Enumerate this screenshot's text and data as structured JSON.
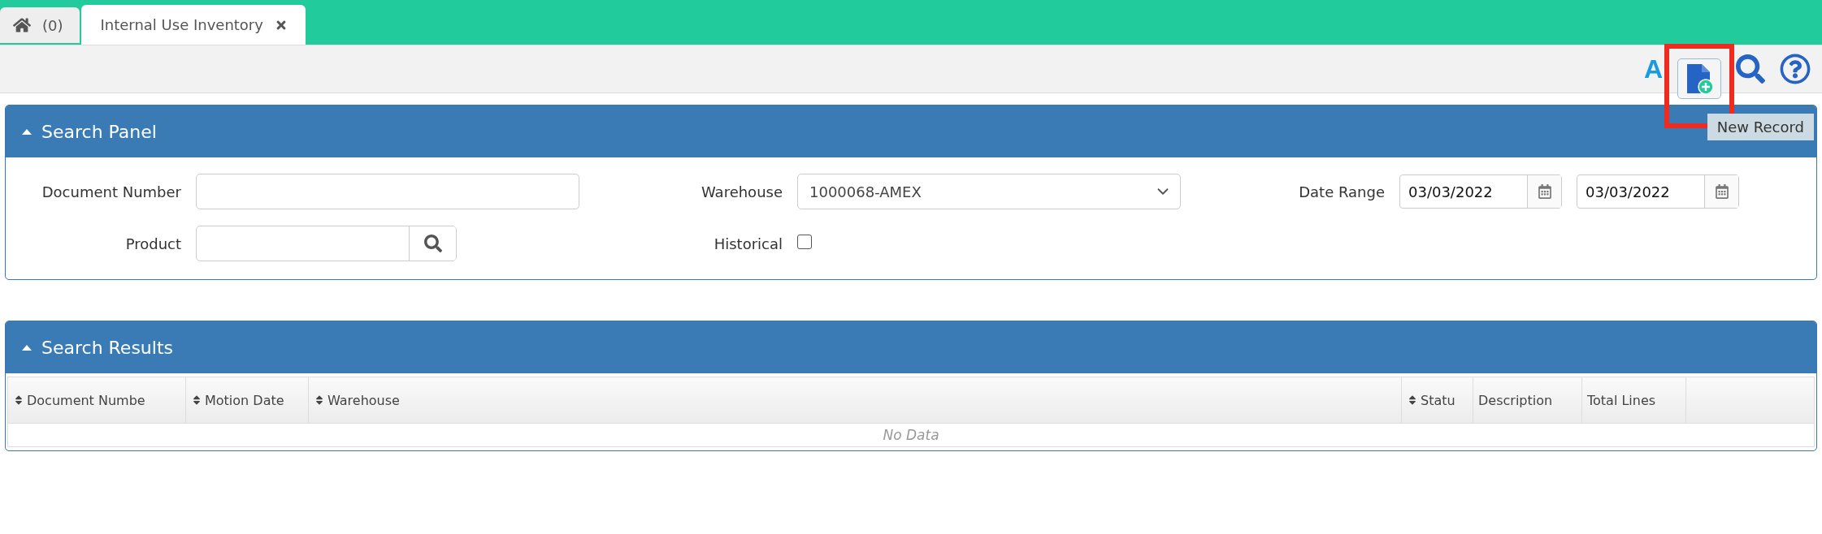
{
  "tabs": [
    {
      "kind": "home",
      "label": "(0)",
      "selected": false
    },
    {
      "kind": "page",
      "label": "Internal Use Inventory",
      "selected": true,
      "closable": true
    }
  ],
  "toolbar": {
    "font_button": "A",
    "new_record": {
      "highlighted": true,
      "tooltip": "New Record"
    }
  },
  "search_panel": {
    "title": "Search Panel",
    "expanded": true,
    "rows": [
      [
        {
          "kind": "text",
          "label": "Document Number"
        },
        {
          "kind": "select",
          "label": "Warehouse",
          "value": "1000068-AMEX"
        },
        {
          "kind": "daterange",
          "label": "Date Range",
          "values": [
            "03/03/2022",
            "03/03/2022"
          ]
        }
      ],
      [
        {
          "kind": "lookup",
          "label": "Product"
        },
        {
          "kind": "checkbox",
          "label": "Historical",
          "checked": false
        }
      ]
    ]
  },
  "results_panel": {
    "title": "Search Results",
    "expanded": true,
    "columns": [
      {
        "label": "Document Numbe",
        "sortable": true
      },
      {
        "label": "Motion Date",
        "sortable": true
      },
      {
        "label": "Warehouse",
        "sortable": true
      },
      {
        "label": "Statu",
        "sortable": true
      },
      {
        "label": "Description",
        "sortable": false
      },
      {
        "label": "Total Lines",
        "sortable": false
      }
    ],
    "empty_text": "No Data"
  }
}
